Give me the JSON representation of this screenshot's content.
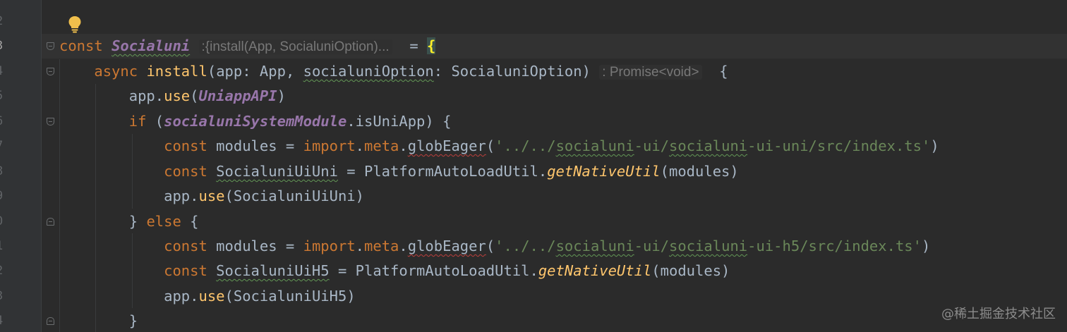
{
  "line_numbers": [
    "2",
    "3",
    "4",
    "5",
    "6",
    "7",
    "8",
    "9",
    "0",
    "1",
    "2",
    "3",
    "4"
  ],
  "hints": {
    "socialuni_type": ":{install(App, SocialuniOption)...",
    "install_return": ": Promise<void>"
  },
  "code": {
    "l3": {
      "kw": "const",
      "name": "Socialuni",
      "eq": "=",
      "brace": "{"
    },
    "l4": {
      "kw": "async",
      "fn": "install",
      "p1": "app",
      "t1": "App",
      "p2": "socialuniOption",
      "t2": "SocialuniOption",
      "brace": "{"
    },
    "l5": {
      "obj": "app.",
      "fn": "use",
      "arg": "UniappAPI"
    },
    "l6": {
      "kw": "if",
      "global": "socialuniSystemModule",
      "prop": ".isUniApp",
      "brace": "{"
    },
    "l7": {
      "kw": "const",
      "var": "modules",
      "imp": "import",
      "meta": "meta",
      "fn": "globEager",
      "str_pre": "'../../",
      "str_a": "socialuni",
      "str_b": "-ui/",
      "str_c": "socialuni",
      "str_d": "-ui-uni/src/index.ts'"
    },
    "l8": {
      "kw": "const",
      "var": "SocialuniUiUni",
      "cls": "PlatformAutoLoadUtil.",
      "fn": "getNativeUtil",
      "arg": "modules"
    },
    "l9": {
      "obj": "app.",
      "fn": "use",
      "arg": "SocialuniUiUni"
    },
    "l10": {
      "close": "}",
      "kw": "else",
      "brace": "{"
    },
    "l11": {
      "kw": "const",
      "var": "modules",
      "imp": "import",
      "meta": "meta",
      "fn": "globEager",
      "str_pre": "'../../",
      "str_a": "socialuni",
      "str_b": "-ui/",
      "str_c": "socialuni",
      "str_d": "-ui-h5/src/index.ts'"
    },
    "l12": {
      "kw": "const",
      "var": "SocialuniUiH5",
      "cls": "PlatformAutoLoadUtil.",
      "fn": "getNativeUtil",
      "arg": "modules"
    },
    "l13": {
      "obj": "app.",
      "fn": "use",
      "arg": "SocialuniUiH5"
    },
    "l14": {
      "close": "}"
    }
  },
  "watermark": "@稀土掘金技术社区",
  "colors": {
    "background": "#2b2b2b",
    "keyword": "#cc7832",
    "function": "#ffc66d",
    "string": "#6a8759",
    "global": "#9876aa",
    "default": "#a9b7c6"
  }
}
